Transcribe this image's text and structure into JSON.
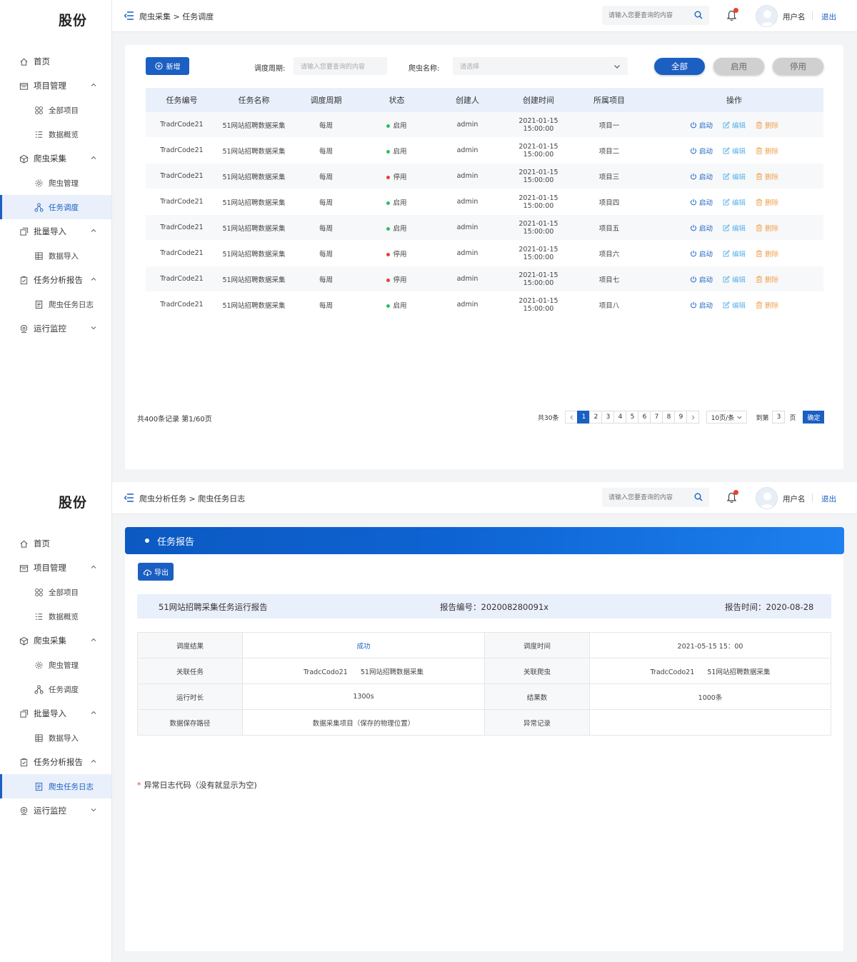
{
  "brand": "股份",
  "colors": {
    "primary": "#1b5fc2",
    "status_on": "#2dbd6e",
    "status_off": "#e8422f",
    "edit": "#5cb3e8",
    "delete": "#f0a04b"
  },
  "header": {
    "search_placeholder": "请输入您要查询的内容",
    "username": "用户名",
    "logout": "退出"
  },
  "sidebar": {
    "home": "首页",
    "project_mgmt": "项目管理",
    "all_projects": "全部项目",
    "data_overview": "数据概览",
    "crawler": "爬虫采集",
    "crawler_mgmt": "爬虫管理",
    "task_schedule": "任务调度",
    "batch_import": "批量导入",
    "data_import": "数据导入",
    "task_report": "任务分析报告",
    "crawler_log": "爬虫任务日志",
    "monitor": "运行监控"
  },
  "screen1": {
    "breadcrumb": "爬虫采集 > 任务调度",
    "add_button": "新增",
    "period_label": "调度周期:",
    "period_placeholder": "请输入您要查询的内容",
    "crawler_label": "爬虫名称:",
    "crawler_placeholder": "请选择",
    "filter_all": "全部",
    "filter_on": "启用",
    "filter_off": "停用",
    "columns": [
      "任务编号",
      "任务名称",
      "调度周期",
      "状态",
      "创建人",
      "创建时间",
      "所属项目",
      "操作"
    ],
    "rows": [
      {
        "code": "TradrCode21",
        "name": "51网站招聘数据采集",
        "period": "每周",
        "status": "启用",
        "on": true,
        "creator": "admin",
        "time": "2021-01-15 15:00:00",
        "project": "项目一"
      },
      {
        "code": "TradrCode21",
        "name": "51网站招聘数据采集",
        "period": "每周",
        "status": "启用",
        "on": true,
        "creator": "admin",
        "time": "2021-01-15 15:00:00",
        "project": "项目二"
      },
      {
        "code": "TradrCode21",
        "name": "51网站招聘数据采集",
        "period": "每周",
        "status": "停用",
        "on": false,
        "creator": "admin",
        "time": "2021-01-15 15:00:00",
        "project": "项目三"
      },
      {
        "code": "TradrCode21",
        "name": "51网站招聘数据采集",
        "period": "每周",
        "status": "启用",
        "on": true,
        "creator": "admin",
        "time": "2021-01-15 15:00:00",
        "project": "项目四"
      },
      {
        "code": "TradrCode21",
        "name": "51网站招聘数据采集",
        "period": "每周",
        "status": "启用",
        "on": true,
        "creator": "admin",
        "time": "2021-01-15 15:00:00",
        "project": "项目五"
      },
      {
        "code": "TradrCode21",
        "name": "51网站招聘数据采集",
        "period": "每周",
        "status": "停用",
        "on": false,
        "creator": "admin",
        "time": "2021-01-15 15:00:00",
        "project": "项目六"
      },
      {
        "code": "TradrCode21",
        "name": "51网站招聘数据采集",
        "period": "每周",
        "status": "停用",
        "on": false,
        "creator": "admin",
        "time": "2021-01-15 15:00:00",
        "project": "项目七"
      },
      {
        "code": "TradrCode21",
        "name": "51网站招聘数据采集",
        "period": "每周",
        "status": "启用",
        "on": true,
        "creator": "admin",
        "time": "2021-01-15 15:00:00",
        "project": "项目八"
      }
    ],
    "op_start": "启动",
    "op_edit": "编辑",
    "op_delete": "删除",
    "total_text": "共400条记录 第1/60页",
    "pager": {
      "count": "共30条",
      "pages": [
        "1",
        "2",
        "3",
        "4",
        "5",
        "6",
        "7",
        "8",
        "9"
      ],
      "current": "1",
      "page_size": "10页/条",
      "goto_label": "到第",
      "goto_value": "3",
      "page_unit": "页",
      "confirm": "确定"
    }
  },
  "screen2": {
    "breadcrumb": "爬虫分析任务 > 爬虫任务日志",
    "banner_title": "任务报告",
    "export_button": "导出",
    "report_title": "51网站招聘采集任务运行报告",
    "report_no": "报告编号：202008280091x",
    "report_time": "报告时间：2020-08-28",
    "details": [
      {
        "k1": "调度结果",
        "v1": "成功",
        "k2": "调度时间",
        "v2": "2021-05-15 15：00"
      },
      {
        "k1": "关联任务",
        "v1": "TradcCodo21      51网站招聘数据采集",
        "k2": "关联爬虫",
        "v2": "TradcCodo21      51网站招聘数据采集"
      },
      {
        "k1": "运行时长",
        "v1": "1300s",
        "k2": "结果数",
        "v2": "1000条"
      },
      {
        "k1": "数据保存路径",
        "v1": "数据采集项目（保存的物理位置）",
        "k2": "异常记录",
        "v2": ""
      }
    ],
    "note": "异常日志代码（没有就显示为空)"
  }
}
